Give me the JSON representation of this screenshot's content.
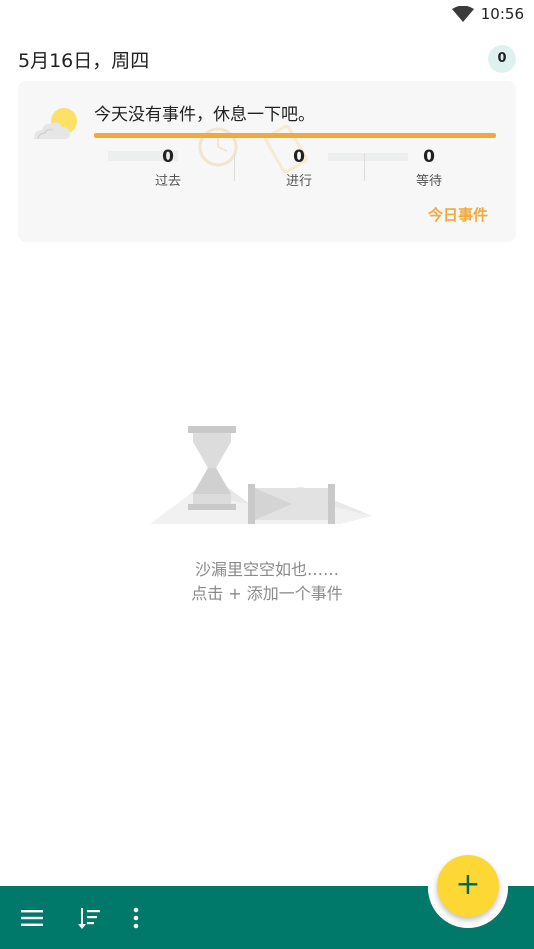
{
  "status_bar": {
    "time": "10:56",
    "wifi_icon": "wifi-icon"
  },
  "header": {
    "date": "5月16日，周四",
    "badge_count": "0"
  },
  "summary": {
    "message": "今天没有事件，休息一下吧。",
    "stats": [
      {
        "value": "0",
        "label": "过去"
      },
      {
        "value": "0",
        "label": "进行"
      },
      {
        "value": "0",
        "label": "等待"
      }
    ],
    "today_link": "今日事件",
    "weather_icon": "partly-sunny-icon"
  },
  "empty_state": {
    "line1": "沙漏里空空如也……",
    "line2": "点击 + 添加一个事件",
    "illustration_icon": "hourglass-icon"
  },
  "bottom_bar": {
    "menu_icon": "menu-icon",
    "sort_icon": "sort-icon",
    "more_icon": "more-vertical-icon"
  },
  "fab": {
    "label": "+"
  },
  "colors": {
    "primary": "#00796b",
    "accent": "#f2a93b",
    "fab": "#fdd835",
    "badge_bg": "#dff1ef"
  }
}
